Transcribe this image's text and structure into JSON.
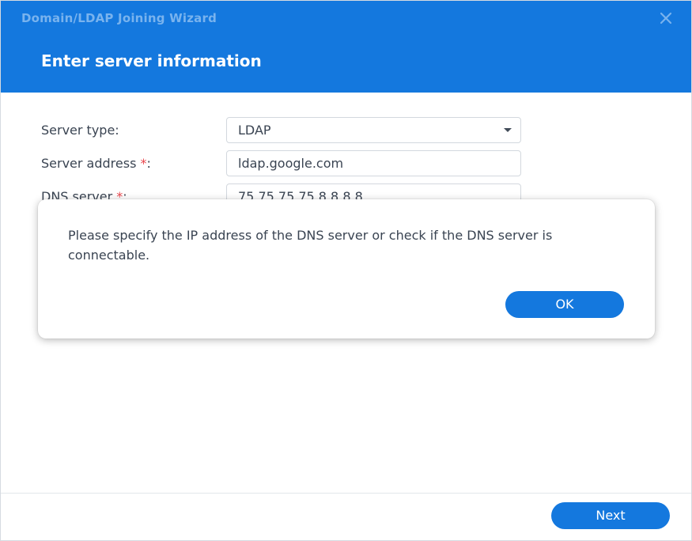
{
  "window": {
    "title": "Domain/LDAP Joining Wizard",
    "step_title": "Enter server information",
    "close_icon": "close-icon"
  },
  "form": {
    "server_type": {
      "label": "Server type:",
      "value": "LDAP"
    },
    "server_address": {
      "label": "Server address ",
      "required_mark": "*",
      "colon": ":",
      "value": "ldap.google.com"
    },
    "dns_server": {
      "label": "DNS server ",
      "required_mark": "*",
      "colon": ":",
      "value": "75.75.75.75,8.8.8.8"
    }
  },
  "dialog": {
    "message": "Please specify the IP address of the DNS server or check if the DNS server is connectable.",
    "ok_label": "OK"
  },
  "footer": {
    "next_label": "Next"
  },
  "colors": {
    "accent": "#1478de",
    "required": "#e8454b",
    "text": "#3a4452"
  }
}
